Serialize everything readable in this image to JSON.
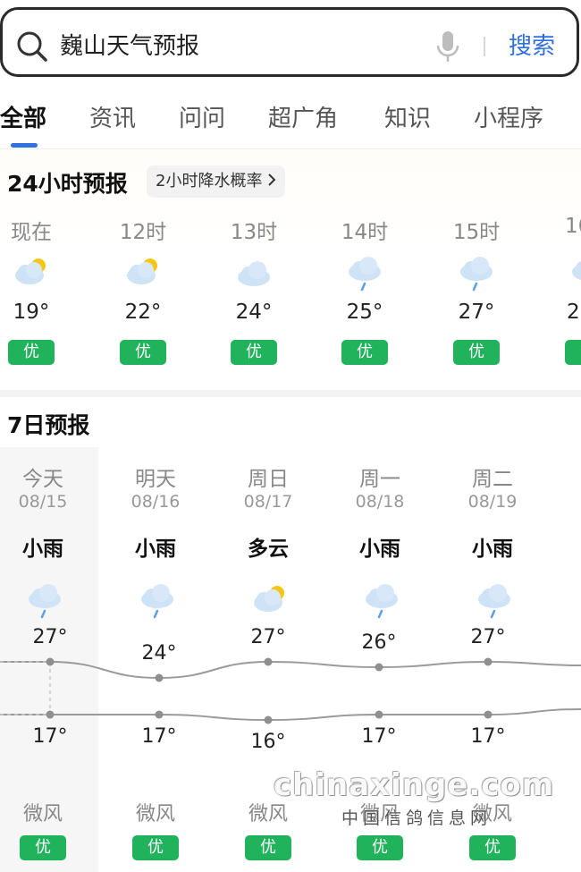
{
  "search": {
    "query": "巍山天气预报",
    "button_label": "搜索",
    "icons": [
      "search-icon",
      "microphone-icon"
    ]
  },
  "tabs": [
    {
      "label": "全部",
      "active": true
    },
    {
      "label": "资讯",
      "active": false
    },
    {
      "label": "问问",
      "active": false
    },
    {
      "label": "超广角",
      "active": false
    },
    {
      "label": "知识",
      "active": false
    },
    {
      "label": "小程序",
      "active": false
    }
  ],
  "hourly": {
    "title": "24小时预报",
    "chip_label": "2小时降水概率",
    "items": [
      {
        "label": "现在",
        "icon": "partly-cloudy-icon",
        "temp": "19°",
        "aqi": "优"
      },
      {
        "label": "12时",
        "icon": "partly-cloudy-icon",
        "temp": "22°",
        "aqi": "优"
      },
      {
        "label": "13时",
        "icon": "cloudy-icon",
        "temp": "24°",
        "aqi": "优"
      },
      {
        "label": "14时",
        "icon": "light-rain-icon",
        "temp": "25°",
        "aqi": "优"
      },
      {
        "label": "15时",
        "icon": "light-rain-icon",
        "temp": "27°",
        "aqi": "优"
      },
      {
        "label": "16",
        "icon": "light-rain-icon",
        "temp": "2",
        "aqi": "优"
      }
    ]
  },
  "daily": {
    "title": "7日预报",
    "items": [
      {
        "name": "今天",
        "date": "08/15",
        "weather": "小雨",
        "icon": "light-rain-icon",
        "high": "27°",
        "low": "17°",
        "high_value": 27,
        "low_value": 17,
        "wind": "微风",
        "aqi": "优"
      },
      {
        "name": "明天",
        "date": "08/16",
        "weather": "小雨",
        "icon": "light-rain-icon",
        "high": "24°",
        "low": "17°",
        "high_value": 24,
        "low_value": 17,
        "wind": "微风",
        "aqi": "优"
      },
      {
        "name": "周日",
        "date": "08/17",
        "weather": "多云",
        "icon": "partly-cloudy-icon",
        "high": "27°",
        "low": "16°",
        "high_value": 27,
        "low_value": 16,
        "wind": "微风",
        "aqi": "优"
      },
      {
        "name": "周一",
        "date": "08/18",
        "weather": "小雨",
        "icon": "light-rain-icon",
        "high": "26°",
        "low": "17°",
        "high_value": 26,
        "low_value": 17,
        "wind": "微风",
        "aqi": "优"
      },
      {
        "name": "周二",
        "date": "08/19",
        "weather": "小雨",
        "icon": "light-rain-icon",
        "high": "27°",
        "low": "17°",
        "high_value": 27,
        "low_value": 17,
        "wind": "微风",
        "aqi": "优"
      }
    ]
  },
  "watermark": {
    "text": "chinaxinge.com",
    "subtext": "中国信鸽信息网"
  },
  "colors": {
    "accent": "#2f6fe0",
    "aqi_good": "#21b25c",
    "sun": "#f5c518",
    "cloud": "#cfe3f7"
  }
}
